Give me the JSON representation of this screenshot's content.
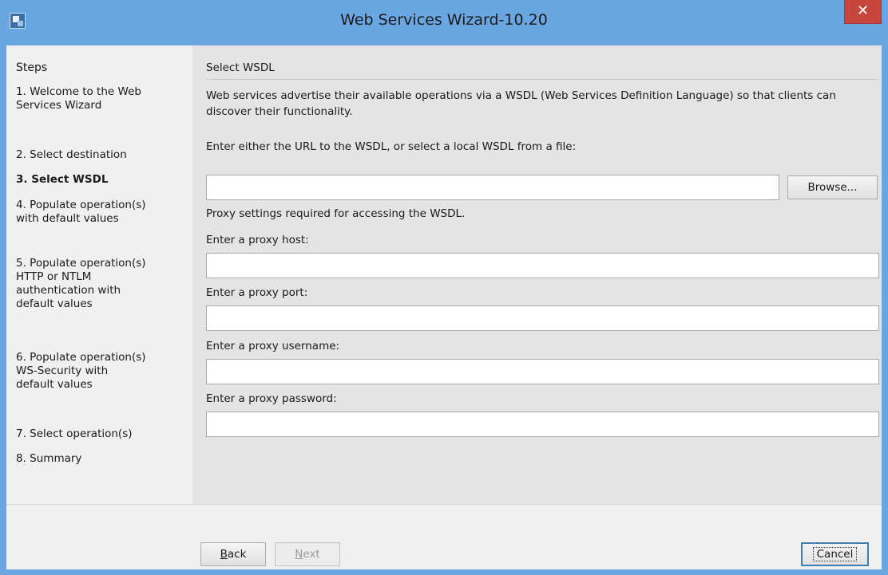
{
  "window": {
    "title": "Web Services Wizard-10.20",
    "close_label": "✕"
  },
  "steps": {
    "header": "Steps",
    "items": [
      {
        "label": "1. Welcome to the Web\n    Services Wizard"
      },
      {
        "label": "2. Select destination"
      },
      {
        "label": "3. Select WSDL"
      },
      {
        "label": "4. Populate operation(s)\n    with default values"
      },
      {
        "label": "5. Populate operation(s)\n    HTTP or NTLM\n    authentication with\n    default values"
      },
      {
        "label": "6. Populate operation(s)\n    WS-Security with\n    default values"
      },
      {
        "label": "7. Select operation(s)"
      },
      {
        "label": "8. Summary"
      }
    ]
  },
  "content": {
    "title": "Select WSDL",
    "description": "Web services advertise their available operations via a WSDL (Web Services Definition Language) so that clients can discover their functionality.",
    "url_prompt": "Enter either the URL to the WSDL, or select a local WSDL from a file:",
    "url_value": "",
    "browse_label": "Browse...",
    "proxy_note": "Proxy settings required for accessing the WSDL.",
    "proxy_host_label": "Enter a proxy host:",
    "proxy_host_value": "",
    "proxy_port_label": "Enter a proxy port:",
    "proxy_port_value": "",
    "proxy_username_label": "Enter a proxy username:",
    "proxy_username_value": "",
    "proxy_password_label": "Enter a proxy password:",
    "proxy_password_value": ""
  },
  "footer": {
    "back_mnemonic": "B",
    "back_rest": "ack",
    "next_mnemonic": "N",
    "next_rest": "ext",
    "cancel_label": "Cancel"
  },
  "colors": {
    "titlebar": "#6aa6e2",
    "close": "#c7463c",
    "content_bg": "#e4e4e4"
  }
}
